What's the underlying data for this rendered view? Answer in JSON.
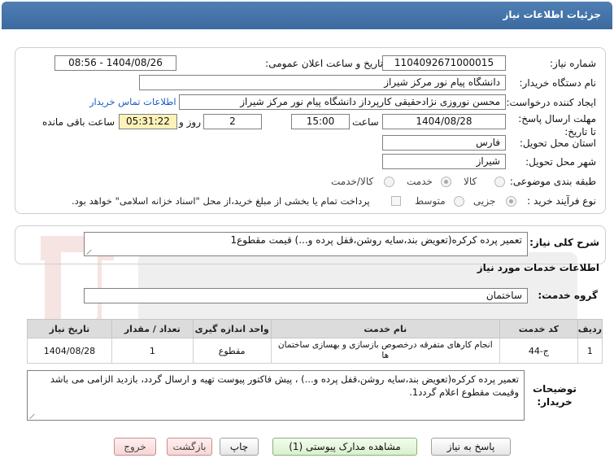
{
  "header": {
    "title": "جزئیات اطلاعات نیاز"
  },
  "form": {
    "need_number_label": "شماره نیاز:",
    "need_number": "1104092671000015",
    "announce_label": "تاریخ و ساعت اعلان عمومی:",
    "announce_value": "1404/08/26 - 08:56",
    "buyer_org_label": "نام دستگاه خریدار:",
    "buyer_org": "دانشگاه پیام نور مرکز شیراز",
    "creator_label": "ایجاد کننده درخواست:",
    "creator": "محسن نوروزی نژادحقیقی کارپرداز دانشگاه پیام نور مرکز شیراز",
    "contact_link": "اطلاعات تماس خریدار",
    "deadline_label": "مهلت ارسال پاسخ: تا تاریخ:",
    "deadline_date": "1404/08/28",
    "time_label": "ساعت",
    "deadline_time": "15:00",
    "days": "2",
    "days_label": "روز و",
    "remaining_time": "05:31:22",
    "remaining_label": "ساعت باقی مانده",
    "province_label": "استان محل تحویل:",
    "province": "فارس",
    "city_label": "شهر محل تحویل:",
    "city": "شیراز",
    "category_label": "طبقه بندی موضوعی:",
    "category_options": [
      "کالا",
      "خدمت",
      "کالا/خدمت"
    ],
    "process_label": "نوع فرآیند خرید :",
    "process_options": [
      "جزیی",
      "متوسط"
    ],
    "payment_note": "پرداخت تمام یا بخشی از مبلغ خرید،از محل \"اسناد خزانه اسلامی\" خواهد بود."
  },
  "summary": {
    "label": "شرح کلی نیاز:",
    "value": "تعمیر پرده کرکره(تعویض بند،سایه روشن،قفل پرده و...) قیمت مقطوع1"
  },
  "services": {
    "section_title": "اطلاعات خدمات مورد نیاز",
    "group_label": "گروه خدمت:",
    "group_value": "ساختمان",
    "columns": [
      "ردیف",
      "کد خدمت",
      "نام خدمت",
      "واحد اندازه گیری",
      "تعداد / مقدار",
      "تاریخ نیاز"
    ],
    "rows": [
      {
        "row": "1",
        "code": "ج-44",
        "name": "انجام کارهای متفرقه درخصوص بازسازی و بهسازی ساختمان ها",
        "unit": "مقطوع",
        "qty": "1",
        "date": "1404/08/28"
      }
    ]
  },
  "buyer_notes": {
    "label": "توضیحات خریدار:",
    "value": "تعمیر پرده کرکره(تعویض بند،سایه روشن،قفل پرده و...) ، پیش فاکتور پیوست تهیه و ارسال گردد، بازدید الزامی می باشد وقیمت مقطوع اعلام گردد1."
  },
  "buttons": {
    "reply": "پاسخ به نیاز",
    "attachments": "مشاهده مدارک پیوستی (1)",
    "print": "چاپ",
    "back": "بازگشت",
    "exit": "خروج"
  }
}
